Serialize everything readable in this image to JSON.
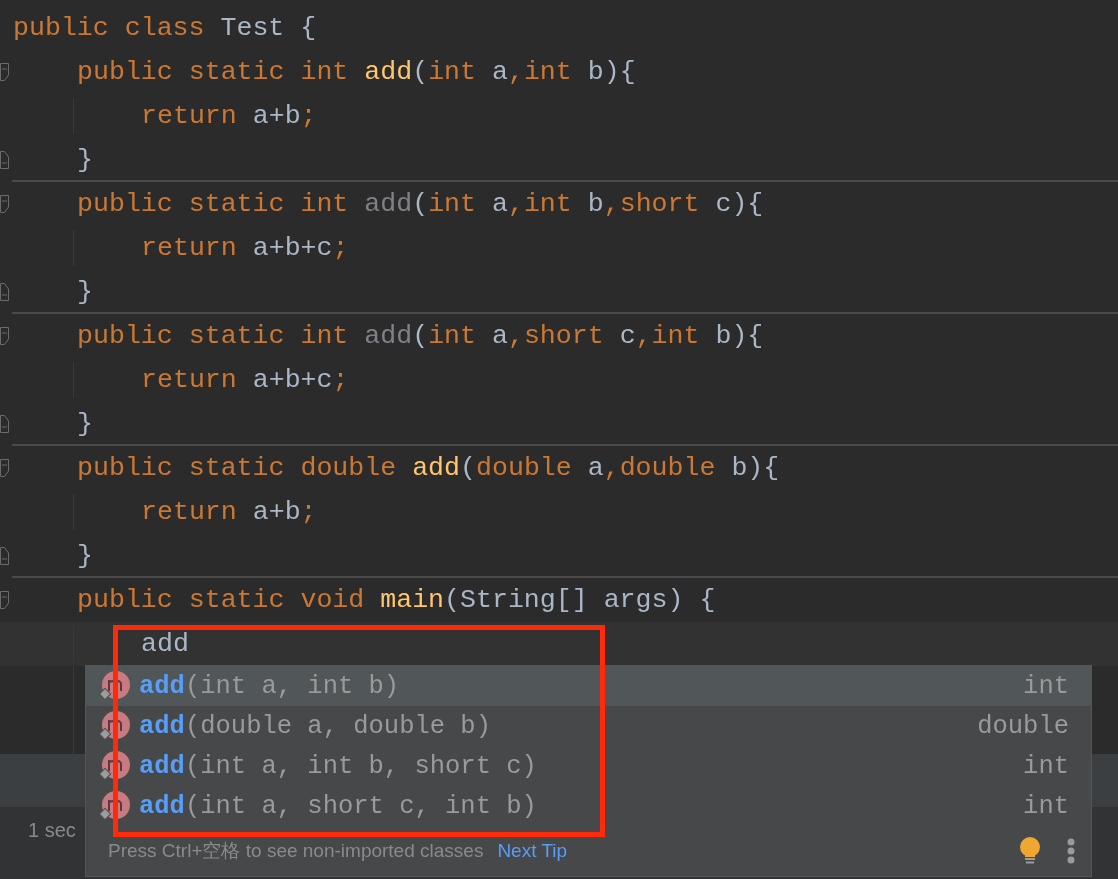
{
  "editor": {
    "lines": [
      {
        "tokens": [
          {
            "text": "public class ",
            "kind": "keyword"
          },
          {
            "text": "Test {",
            "kind": "plain"
          }
        ],
        "children": [
          {
            "tokens": [
              {
                "text": "public static int ",
                "kind": "keyword"
              },
              {
                "text": "add",
                "kind": "method"
              },
              {
                "text": "(",
                "kind": "plain"
              },
              {
                "text": "int ",
                "kind": "keyword"
              },
              {
                "text": "a",
                "kind": "plain"
              },
              {
                "text": ",",
                "kind": "keyword"
              },
              {
                "text": "int ",
                "kind": "keyword"
              },
              {
                "text": "b){",
                "kind": "plain"
              }
            ],
            "children": [
              {
                "tokens": [
                  {
                    "text": "return ",
                    "kind": "keyword"
                  },
                  {
                    "text": "a+b",
                    "kind": "plain"
                  },
                  {
                    "text": ";",
                    "kind": "keyword"
                  }
                ]
              }
            ]
          },
          {
            "separator": true,
            "tokens": [
              {
                "text": "}",
                "kind": "plain"
              }
            ]
          },
          {
            "tokens": [
              {
                "text": "public static int ",
                "kind": "keyword"
              },
              {
                "text": "add",
                "kind": "unused"
              },
              {
                "text": "(",
                "kind": "plain"
              },
              {
                "text": "int ",
                "kind": "keyword"
              },
              {
                "text": "a",
                "kind": "plain"
              },
              {
                "text": ",",
                "kind": "keyword"
              },
              {
                "text": "int ",
                "kind": "keyword"
              },
              {
                "text": "b",
                "kind": "plain"
              },
              {
                "text": ",",
                "kind": "keyword"
              },
              {
                "text": "short ",
                "kind": "keyword"
              },
              {
                "text": "c){",
                "kind": "plain"
              }
            ],
            "children": [
              {
                "tokens": [
                  {
                    "text": "return ",
                    "kind": "keyword"
                  },
                  {
                    "text": "a+b+c",
                    "kind": "plain"
                  },
                  {
                    "text": ";",
                    "kind": "keyword"
                  }
                ]
              }
            ]
          },
          {
            "separator": true,
            "tokens": [
              {
                "text": "}",
                "kind": "plain"
              }
            ]
          },
          {
            "tokens": [
              {
                "text": "public static int ",
                "kind": "keyword"
              },
              {
                "text": "add",
                "kind": "unused"
              },
              {
                "text": "(",
                "kind": "plain"
              },
              {
                "text": "int ",
                "kind": "keyword"
              },
              {
                "text": "a",
                "kind": "plain"
              },
              {
                "text": ",",
                "kind": "keyword"
              },
              {
                "text": "short ",
                "kind": "keyword"
              },
              {
                "text": "c",
                "kind": "plain"
              },
              {
                "text": ",",
                "kind": "keyword"
              },
              {
                "text": "int ",
                "kind": "keyword"
              },
              {
                "text": "b){",
                "kind": "plain"
              }
            ],
            "children": [
              {
                "tokens": [
                  {
                    "text": "return ",
                    "kind": "keyword"
                  },
                  {
                    "text": "a+b+c",
                    "kind": "plain"
                  },
                  {
                    "text": ";",
                    "kind": "keyword"
                  }
                ]
              }
            ]
          },
          {
            "separator": true,
            "tokens": [
              {
                "text": "}",
                "kind": "plain"
              }
            ]
          },
          {
            "tokens": [
              {
                "text": "public static double ",
                "kind": "keyword"
              },
              {
                "text": "add",
                "kind": "method"
              },
              {
                "text": "(",
                "kind": "plain"
              },
              {
                "text": "double ",
                "kind": "keyword"
              },
              {
                "text": "a",
                "kind": "plain"
              },
              {
                "text": ",",
                "kind": "keyword"
              },
              {
                "text": "double ",
                "kind": "keyword"
              },
              {
                "text": "b){",
                "kind": "plain"
              }
            ],
            "children": [
              {
                "tokens": [
                  {
                    "text": "return ",
                    "kind": "keyword"
                  },
                  {
                    "text": "a+b",
                    "kind": "plain"
                  },
                  {
                    "text": ";",
                    "kind": "keyword"
                  }
                ]
              }
            ]
          },
          {
            "separator": true,
            "tokens": [
              {
                "text": "}",
                "kind": "plain"
              }
            ]
          },
          {
            "tokens": [
              {
                "text": "public static void ",
                "kind": "keyword"
              },
              {
                "text": "main",
                "kind": "method"
              },
              {
                "text": "(String[] args) {",
                "kind": "plain"
              }
            ],
            "children": [
              {
                "current": true,
                "tokens": [
                  {
                    "text": "add",
                    "kind": "plain"
                  }
                ]
              }
            ]
          }
        ]
      }
    ]
  },
  "completion": {
    "items": [
      {
        "name": "add",
        "params": "(int a, int b)",
        "type": "int",
        "selected": true
      },
      {
        "name": "add",
        "params": "(double a, double b)",
        "type": "double",
        "selected": false
      },
      {
        "name": "add",
        "params": "(int a, int b, short c)",
        "type": "int",
        "selected": false
      },
      {
        "name": "add",
        "params": "(int a, short c, int b)",
        "type": "int",
        "selected": false
      }
    ],
    "hint": "Press Ctrl+空格 to see non-imported classes",
    "next_tip": "Next Tip"
  },
  "bottom_panel": {
    "time": "1 sec"
  }
}
